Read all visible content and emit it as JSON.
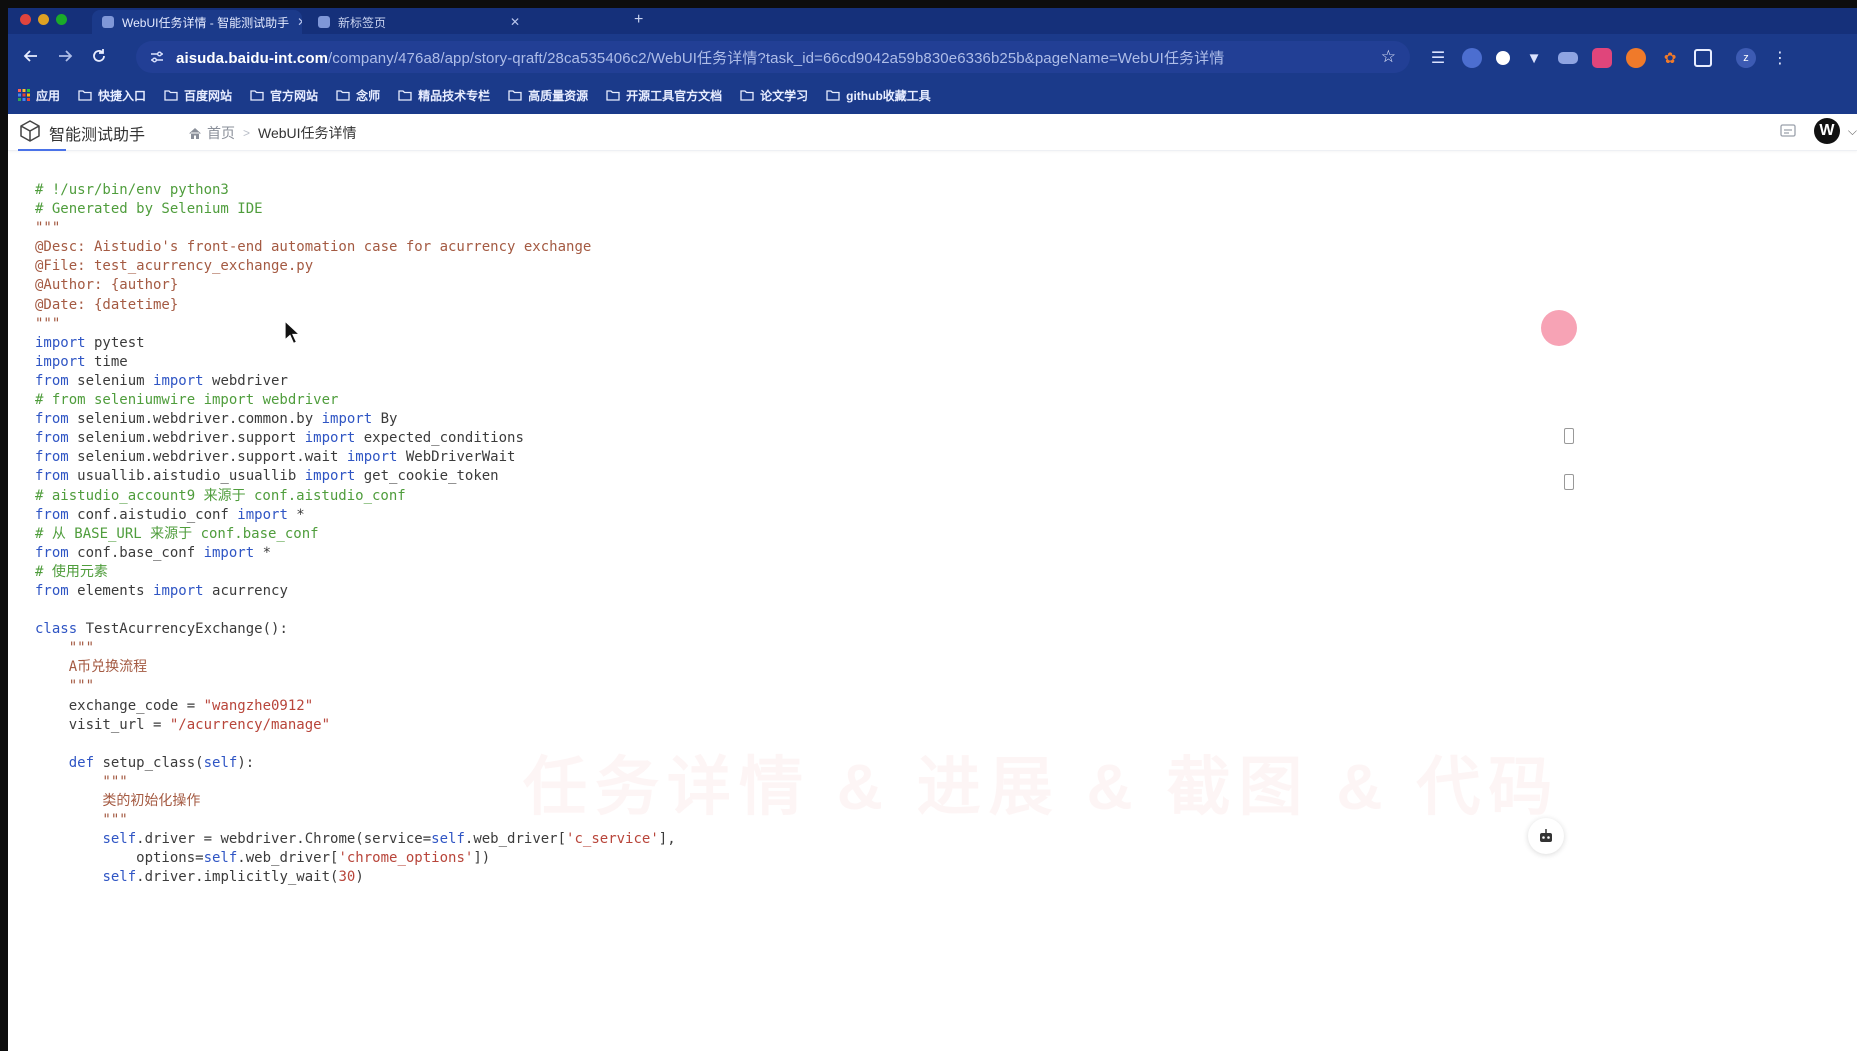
{
  "browser": {
    "tabs": [
      {
        "label": "WebUI任务详情 - 智能测试助手"
      },
      {
        "label": "新标签页"
      }
    ],
    "new_tab_glyph": "+",
    "url_host": "aisuda.baidu-int.com",
    "url_path": "/company/476a8/app/story-qraft/28ca535406c2/WebUI任务详情?task_id=66cd9042a59b830e6336b25b&pageName=WebUI任务详情",
    "bookmarks": [
      {
        "label": "应用",
        "icon": "apps-grid-icon"
      },
      {
        "label": "快捷入口",
        "icon": "folder-icon"
      },
      {
        "label": "百度网站",
        "icon": "folder-icon"
      },
      {
        "label": "官方网站",
        "icon": "folder-icon"
      },
      {
        "label": "念师",
        "icon": "folder-icon"
      },
      {
        "label": "精品技术专栏",
        "icon": "folder-icon"
      },
      {
        "label": "高质量资源",
        "icon": "folder-icon"
      },
      {
        "label": "开源工具官方文档",
        "icon": "folder-icon"
      },
      {
        "label": "论文学习",
        "icon": "folder-icon"
      },
      {
        "label": "github收藏工具",
        "icon": "folder-icon"
      }
    ],
    "profile_initial": "z"
  },
  "app": {
    "title": "智能测试助手",
    "breadcrumb": {
      "home": "首页",
      "separator": ">",
      "current": "WebUI任务详情"
    },
    "avatar_initial": "W",
    "accent_color": "#4a72e8"
  },
  "watermark": "任务详情 & 进展 & 截图 & 代码",
  "code_lines": [
    {
      "cls": "com",
      "text": "# !/usr/bin/env python3"
    },
    {
      "cls": "com",
      "text": "# Generated by Selenium IDE"
    },
    {
      "cls": "doc",
      "text": "\"\"\""
    },
    {
      "cls": "doc",
      "text": "@Desc: Aistudio's front-end automation case for acurrency exchange"
    },
    {
      "cls": "doc",
      "text": "@File: test_acurrency_exchange.py"
    },
    {
      "cls": "doc",
      "text": "@Author: {author}"
    },
    {
      "cls": "doc",
      "text": "@Date: {datetime}"
    },
    {
      "cls": "doc",
      "text": "\"\"\""
    },
    {
      "segs": [
        {
          "c": "kw",
          "t": "import"
        },
        {
          "t": " pytest"
        }
      ]
    },
    {
      "segs": [
        {
          "c": "kw",
          "t": "import"
        },
        {
          "t": " time"
        }
      ]
    },
    {
      "segs": [
        {
          "c": "kw",
          "t": "from"
        },
        {
          "t": " selenium "
        },
        {
          "c": "kw",
          "t": "import"
        },
        {
          "t": " webdriver"
        }
      ]
    },
    {
      "cls": "com",
      "text": "# from seleniumwire import webdriver"
    },
    {
      "segs": [
        {
          "c": "kw",
          "t": "from"
        },
        {
          "t": " selenium.webdriver.common.by "
        },
        {
          "c": "kw",
          "t": "import"
        },
        {
          "t": " By"
        }
      ]
    },
    {
      "segs": [
        {
          "c": "kw",
          "t": "from"
        },
        {
          "t": " selenium.webdriver.support "
        },
        {
          "c": "kw",
          "t": "import"
        },
        {
          "t": " expected_conditions"
        }
      ]
    },
    {
      "segs": [
        {
          "c": "kw",
          "t": "from"
        },
        {
          "t": " selenium.webdriver.support.wait "
        },
        {
          "c": "kw",
          "t": "import"
        },
        {
          "t": " WebDriverWait"
        }
      ]
    },
    {
      "segs": [
        {
          "c": "kw",
          "t": "from"
        },
        {
          "t": " usuallib.aistudio_usuallib "
        },
        {
          "c": "kw",
          "t": "import"
        },
        {
          "t": " get_cookie_token"
        }
      ]
    },
    {
      "cls": "com",
      "text": "# aistudio_account9 来源于 conf.aistudio_conf"
    },
    {
      "segs": [
        {
          "c": "kw",
          "t": "from"
        },
        {
          "t": " conf.aistudio_conf "
        },
        {
          "c": "kw",
          "t": "import"
        },
        {
          "t": " *"
        }
      ]
    },
    {
      "cls": "com",
      "text": "# 从 BASE_URL 来源于 conf.base_conf"
    },
    {
      "segs": [
        {
          "c": "kw",
          "t": "from"
        },
        {
          "t": " conf.base_conf "
        },
        {
          "c": "kw",
          "t": "import"
        },
        {
          "t": " *"
        }
      ]
    },
    {
      "cls": "com",
      "text": "# 使用元素"
    },
    {
      "segs": [
        {
          "c": "kw",
          "t": "from"
        },
        {
          "t": " elements "
        },
        {
          "c": "kw",
          "t": "import"
        },
        {
          "t": " acurrency"
        }
      ]
    },
    {
      "text": ""
    },
    {
      "segs": [
        {
          "c": "kw",
          "t": "class"
        },
        {
          "t": " TestAcurrencyExchange():"
        }
      ]
    },
    {
      "cls": "doc",
      "text": "    \"\"\""
    },
    {
      "cls": "doc",
      "text": "    A币兑换流程"
    },
    {
      "cls": "doc",
      "text": "    \"\"\""
    },
    {
      "segs": [
        {
          "t": "    exchange_code = "
        },
        {
          "c": "str",
          "t": "\"wangzhe0912\""
        }
      ]
    },
    {
      "segs": [
        {
          "t": "    visit_url = "
        },
        {
          "c": "str",
          "t": "\"/acurrency/manage\""
        }
      ]
    },
    {
      "text": ""
    },
    {
      "segs": [
        {
          "t": "    "
        },
        {
          "c": "kw",
          "t": "def"
        },
        {
          "t": " setup_class("
        },
        {
          "c": "kw",
          "t": "self"
        },
        {
          "t": "):"
        }
      ]
    },
    {
      "cls": "doc",
      "text": "        \"\"\""
    },
    {
      "cls": "doc",
      "text": "        类的初始化操作"
    },
    {
      "cls": "doc",
      "text": "        \"\"\""
    },
    {
      "segs": [
        {
          "t": "        "
        },
        {
          "c": "kw",
          "t": "self"
        },
        {
          "t": ".driver = webdriver.Chrome(service="
        },
        {
          "c": "kw",
          "t": "self"
        },
        {
          "t": ".web_driver["
        },
        {
          "c": "str",
          "t": "'c_service'"
        },
        {
          "t": "],"
        }
      ]
    },
    {
      "segs": [
        {
          "t": "            options="
        },
        {
          "c": "kw",
          "t": "self"
        },
        {
          "t": ".web_driver["
        },
        {
          "c": "str",
          "t": "'chrome_options'"
        },
        {
          "t": "])"
        }
      ]
    },
    {
      "segs": [
        {
          "t": "        "
        },
        {
          "c": "kw",
          "t": "self"
        },
        {
          "t": ".driver.implicitly_wait("
        },
        {
          "c": "str",
          "t": "30"
        },
        {
          "t": ")"
        }
      ]
    }
  ]
}
